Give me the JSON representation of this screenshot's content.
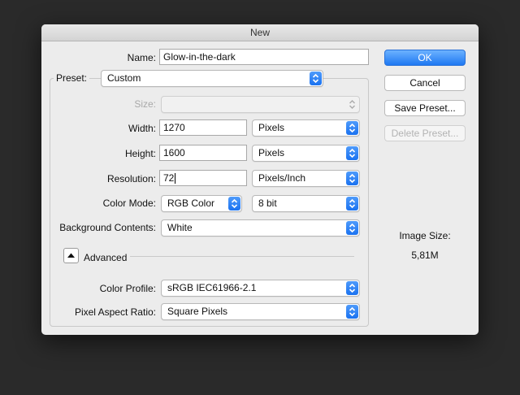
{
  "dialog": {
    "title": "New"
  },
  "name": {
    "label": "Name:",
    "value": "Glow-in-the-dark"
  },
  "preset": {
    "label": "Preset:",
    "value": "Custom"
  },
  "size": {
    "label": "Size:",
    "value": ""
  },
  "width": {
    "label": "Width:",
    "value": "1270",
    "unit": "Pixels"
  },
  "height": {
    "label": "Height:",
    "value": "1600",
    "unit": "Pixels"
  },
  "resolution": {
    "label": "Resolution:",
    "value": "72",
    "unit": "Pixels/Inch"
  },
  "color_mode": {
    "label": "Color Mode:",
    "mode": "RGB Color",
    "depth": "8 bit"
  },
  "background": {
    "label": "Background Contents:",
    "value": "White"
  },
  "advanced": {
    "label": "Advanced"
  },
  "color_profile": {
    "label": "Color Profile:",
    "value": "sRGB IEC61966-2.1"
  },
  "pixel_aspect": {
    "label": "Pixel Aspect Ratio:",
    "value": "Square Pixels"
  },
  "buttons": {
    "ok": "OK",
    "cancel": "Cancel",
    "save_preset": "Save Preset...",
    "delete_preset": "Delete Preset..."
  },
  "image_size": {
    "label": "Image Size:",
    "value": "5,81M"
  },
  "colors": {
    "accent": "#1f78f2",
    "background": "#2a2a2a",
    "dialog": "#ececec"
  }
}
